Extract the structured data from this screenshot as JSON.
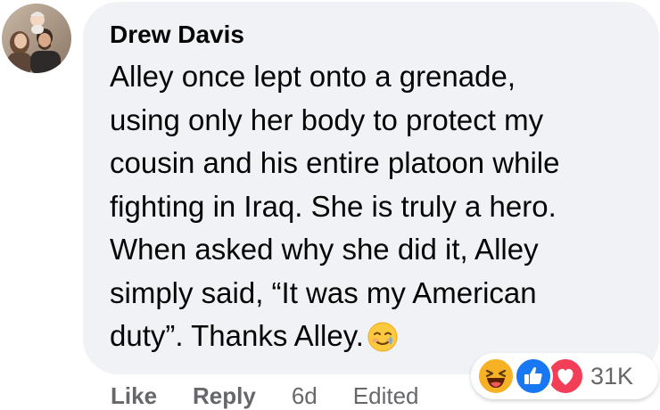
{
  "comment": {
    "author": "Drew Davis",
    "text": "Alley once lept onto a grenade,\nusing only her body to protect my\ncousin and his entire platoon while\nfighting in Iraq. She is truly a hero.\nWhen asked why she did it, Alley\nsimply said, “It was my American\nduty”. Thanks Alley.",
    "inline_emoji": "smiling-face-with-tear-icon"
  },
  "actions": {
    "like_label": "Like",
    "reply_label": "Reply",
    "time": "6d",
    "edited_label": "Edited"
  },
  "reactions": {
    "icons": [
      "haha-icon",
      "like-icon",
      "love-icon"
    ],
    "count": "31K"
  },
  "colors": {
    "bubble": "#f0f2f5",
    "text": "#050505",
    "secondary": "#65676b",
    "like_blue": "#1877f2",
    "love_red": "#f33e58",
    "haha_yellow": "#f7b125"
  }
}
